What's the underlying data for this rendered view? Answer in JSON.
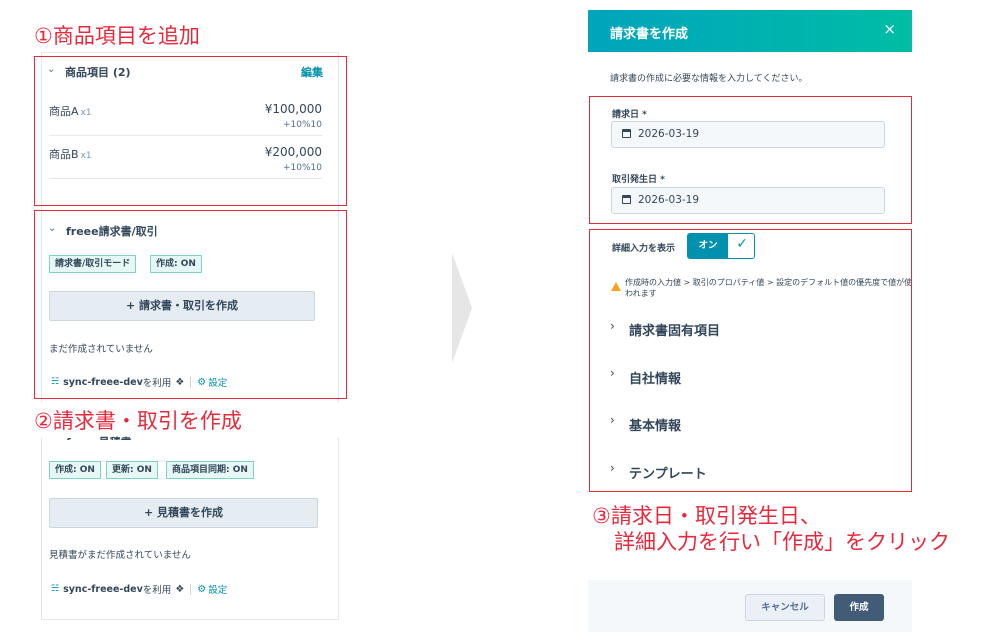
{
  "annotations": {
    "step1": "①商品項目を追加",
    "step2": "②請求書・取引を作成",
    "step3_line1": "③請求日・取引発生日、",
    "step3_line2": "詳細入力を行い「作成」をクリック"
  },
  "line_items": {
    "title": "商品項目 (2)",
    "edit_label": "編集",
    "items": [
      {
        "name": "商品A",
        "qty": "x1",
        "price": "¥100,000",
        "tax": "+10%10"
      },
      {
        "name": "商品B",
        "qty": "x1",
        "price": "¥200,000",
        "tax": "+10%10"
      }
    ]
  },
  "freee_invoice": {
    "title": "freee請求書/取引",
    "tags": [
      "請求書/取引モード",
      "作成: ON"
    ],
    "create_button": "+ 請求書・取引を作成",
    "empty_text": "まだ作成されていません",
    "sync_name": "sync-freee-dev",
    "sync_suffix": "を利用",
    "settings_label": "設定"
  },
  "freee_estimate": {
    "title_partial": "freee見積書",
    "tags": [
      "作成: ON",
      "更新: ON",
      "商品項目同期: ON"
    ],
    "create_button": "+ 見積書を作成",
    "empty_text": "見積書がまだ作成されていません",
    "sync_name": "sync-freee-dev",
    "sync_suffix": "を利用",
    "settings_label": "設定"
  },
  "modal": {
    "title": "請求書を作成",
    "close": "×",
    "description": "請求書の作成に必要な情報を入力してください。",
    "invoice_date_label": "請求日 *",
    "invoice_date_value": "2026-03-19",
    "transaction_date_label": "取引発生日 *",
    "transaction_date_value": "2026-03-19",
    "detail_toggle_label": "詳細入力を表示",
    "detail_toggle_state": "オン",
    "warning": "作成時の入力値 > 取引のプロパティ値 > 設定のデフォルト値の優先度で値が使われます",
    "sections": [
      "請求書固有項目",
      "自社情報",
      "基本情報",
      "テンプレート"
    ],
    "cancel_button": "キャンセル",
    "create_button": "作成"
  },
  "colors": {
    "annotation_red": "#e8283b",
    "header_gradient_start": "#00a4bd",
    "header_gradient_end": "#00bda5",
    "toggle_teal": "#0091ae",
    "primary_button": "#425b76"
  }
}
